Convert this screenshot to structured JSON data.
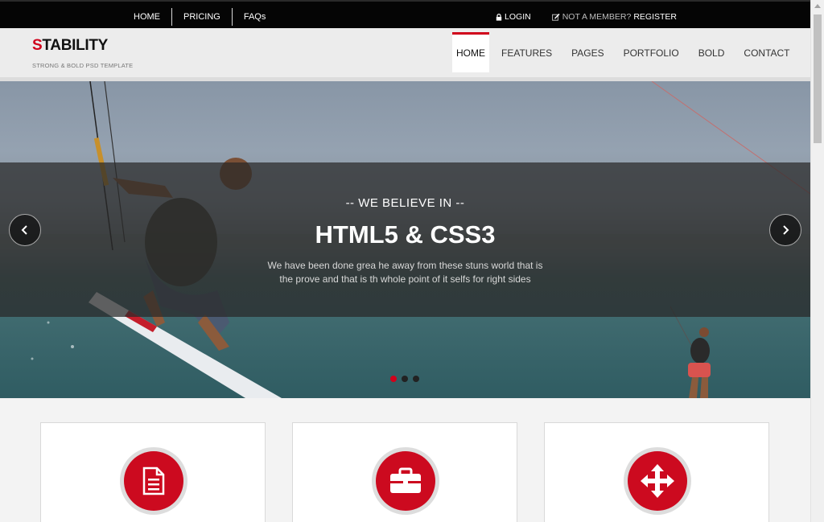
{
  "topbar": {
    "nav": [
      {
        "label": "HOME"
      },
      {
        "label": "PRICING"
      },
      {
        "label": "FAQs"
      }
    ],
    "login": "LOGIN",
    "member_prompt": "NOT A MEMBER?",
    "register": "REGISTER"
  },
  "header": {
    "logo_first": "S",
    "logo_rest": "TABILITY",
    "tagline": "STRONG & BOLD PSD TEMPLATE",
    "nav": [
      {
        "label": "HOME",
        "active": true
      },
      {
        "label": "FEATURES"
      },
      {
        "label": "PAGES"
      },
      {
        "label": "PORTFOLIO"
      },
      {
        "label": "BOLD"
      },
      {
        "label": "CONTACT"
      }
    ]
  },
  "hero": {
    "tag": "-- WE BELIEVE IN --",
    "headline": "HTML5 & CSS3",
    "description": "We have been done grea he away from these stuns world that is the prove and that is th whole point of it selfs for right sides",
    "slides": 3,
    "active_slide": 1
  },
  "features": [
    {
      "icon": "document-icon"
    },
    {
      "icon": "briefcase-icon"
    },
    {
      "icon": "move-arrows-icon"
    }
  ],
  "colors": {
    "accent": "#d0021b",
    "topbar": "#050505",
    "header": "#ececec"
  }
}
